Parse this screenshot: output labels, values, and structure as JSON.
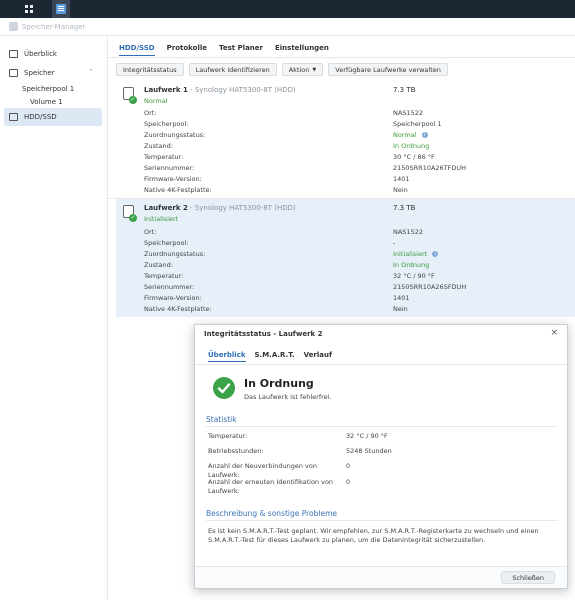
{
  "window": {
    "title": "Speicher-Manager"
  },
  "sidebar": {
    "items": [
      {
        "label": "Überblick"
      },
      {
        "label": "Speicher"
      },
      {
        "label": "Speicherpool 1"
      },
      {
        "label": "Volume 1"
      },
      {
        "label": "HDD/SSD"
      }
    ]
  },
  "tabs": [
    "HDD/SSD",
    "Protokolle",
    "Test Planer",
    "Einstellungen"
  ],
  "toolbar": {
    "integrity": "Integritätsstatus",
    "identify": "Laufwerk identifizieren",
    "action": "Aktion",
    "manage": "Verfügbare Laufwerke verwalten"
  },
  "drives": [
    {
      "name": "Laufwerk 1",
      "model": "- Synology HAT5300-8T (HDD)",
      "state": "Normal",
      "size": "7.3 TB",
      "props": [
        {
          "k": "Ort:",
          "v": "NAS1522"
        },
        {
          "k": "Speicherpool:",
          "v": "Speicherpool 1"
        },
        {
          "k": "Zuordnungsstatus:",
          "v": "Normal"
        },
        {
          "k": "Zustand:",
          "v": "In Ordnung"
        },
        {
          "k": "Temperatur:",
          "v": "30 °C / 86 °F"
        },
        {
          "k": "Seriennummer:",
          "v": "2150SRR10A26TFDUH"
        },
        {
          "k": "Firmware-Version:",
          "v": "1401"
        },
        {
          "k": "Native 4K-Festplatte:",
          "v": "Nein"
        }
      ]
    },
    {
      "name": "Laufwerk 2",
      "model": "- Synology HAT5300-8T (HDD)",
      "state": "Initialisiert",
      "size": "7.3 TB",
      "props": [
        {
          "k": "Ort:",
          "v": "NAS1522"
        },
        {
          "k": "Speicherpool:",
          "v": "-"
        },
        {
          "k": "Zuordnungsstatus:",
          "v": "Initialisiert"
        },
        {
          "k": "Zustand:",
          "v": "In Ordnung"
        },
        {
          "k": "Temperatur:",
          "v": "32 °C / 90 °F"
        },
        {
          "k": "Seriennummer:",
          "v": "2150SRR10A26SFDUH"
        },
        {
          "k": "Firmware-Version:",
          "v": "1401"
        },
        {
          "k": "Native 4K-Festplatte:",
          "v": "Nein"
        }
      ]
    }
  ],
  "dialog": {
    "title": "Integritätsstatus - Laufwerk 2",
    "tabs": [
      "Überblick",
      "S.M.A.R.T.",
      "Verlauf"
    ],
    "status_title": "In Ordnung",
    "status_sub": "Das Laufwerk ist fehlerfrei.",
    "stats_heading": "Statistik",
    "stats": [
      {
        "k": "Temperatur:",
        "v": "32 °C / 90 °F"
      },
      {
        "k": "Betriebsstunden:",
        "v": "5248 Stunden"
      },
      {
        "k": "Anzahl der Neuverbindungen von Laufwerk:",
        "v": "0"
      },
      {
        "k": "Anzahl der erneuten Identifikation von Laufwerk:",
        "v": "0"
      }
    ],
    "desc_heading": "Beschreibung & sonstige Probleme",
    "desc": "Es ist kein S.M.A.R.T.-Test geplant. Wir empfehlen, zur S.M.A.R.T.-Registerkarte zu wechseln und einen S.M.A.R.T.-Test für dieses Laufwerk zu planen, um die Datenintegrität sicherzustellen.",
    "close_label": "Schließen"
  }
}
